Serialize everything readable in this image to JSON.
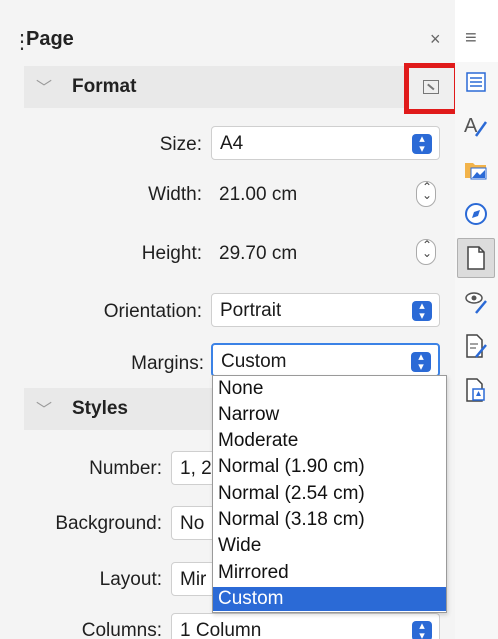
{
  "panel": {
    "title": "Page",
    "close_glyph": "×",
    "menu_glyph": "≡"
  },
  "format": {
    "header": "Format",
    "size_label": "Size:",
    "size_value": "A4",
    "width_label": "Width:",
    "width_value": "21.00 cm",
    "height_label": "Height:",
    "height_value": "29.70 cm",
    "orientation_label": "Orientation:",
    "orientation_value": "Portrait",
    "margins_label": "Margins:",
    "margins_value": "Custom"
  },
  "styles": {
    "header": "Styles",
    "number_label": "Number:",
    "number_value": "1, 2",
    "background_label": "Background:",
    "background_value": "No",
    "layout_label": "Layout:",
    "layout_value": "Mir",
    "columns_label": "Columns:",
    "columns_value": "1 Column"
  },
  "margins_dropdown": {
    "options": [
      "None",
      "Narrow",
      "Moderate",
      "Normal (1.90 cm)",
      "Normal (2.54 cm)",
      "Normal (3.18 cm)",
      "Wide",
      "Mirrored",
      "Custom"
    ],
    "selected": "Custom"
  },
  "sidebar_tabs": [
    {
      "icon": "properties-icon"
    },
    {
      "icon": "styles-icon"
    },
    {
      "icon": "gallery-icon"
    },
    {
      "icon": "navigator-icon"
    },
    {
      "icon": "page-icon",
      "active": true
    },
    {
      "icon": "style-inspector-icon"
    },
    {
      "icon": "manage-changes-icon"
    },
    {
      "icon": "design-icon"
    }
  ],
  "colors": {
    "accent": "#2b6ad6",
    "highlight_box": "#e01a1a"
  }
}
